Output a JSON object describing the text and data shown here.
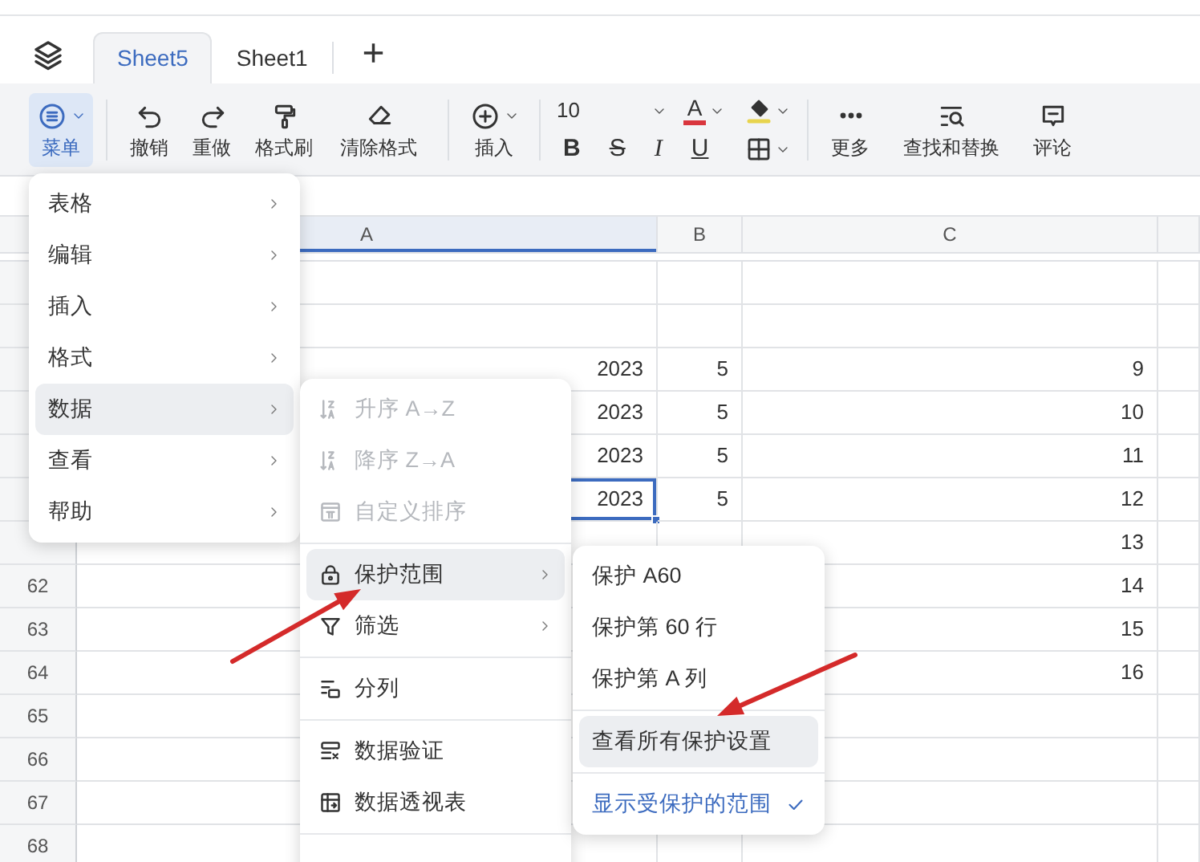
{
  "tab_bar": {
    "tabs": [
      {
        "label": "Sheet5",
        "selected": true
      },
      {
        "label": "Sheet1",
        "selected": false
      }
    ],
    "add_label": "+"
  },
  "toolbar": {
    "menu_button": {
      "label": "菜单",
      "active": true
    },
    "edit_buttons": [
      "撤销",
      "重做",
      "格式刷",
      "清除格式"
    ],
    "insert_button": "插入",
    "font_size": "10",
    "font_color_label": "A",
    "format_buttons": [
      "B",
      "S",
      "I",
      "U"
    ],
    "more_buttons": [
      "更多",
      "查找和替换",
      "评论"
    ]
  },
  "grid": {
    "columns": [
      {
        "label": "A",
        "selected": true
      },
      {
        "label": "B",
        "selected": false
      },
      {
        "label": "C",
        "selected": false
      }
    ],
    "rows": [
      {
        "cells": [
          {
            "kind": "plain"
          },
          {
            "kind": "plain"
          },
          {
            "kind": "plain"
          }
        ]
      },
      {
        "cells": [
          {
            "kind": "plain"
          },
          {
            "kind": "plain"
          },
          {
            "kind": "plain"
          }
        ]
      },
      {
        "cells": [
          {
            "kind": "plain",
            "text": "2023"
          },
          {
            "kind": "plain",
            "text": "5"
          },
          {
            "kind": "plain",
            "text": "9"
          }
        ]
      },
      {
        "cells": [
          {
            "kind": "plain",
            "text": "2023"
          },
          {
            "kind": "plain",
            "text": "5"
          },
          {
            "kind": "plain",
            "text": "10"
          }
        ]
      },
      {
        "cells": [
          {
            "kind": "plain",
            "text": "2023"
          },
          {
            "kind": "plain",
            "text": "5"
          },
          {
            "kind": "plain",
            "text": "11"
          }
        ]
      },
      {
        "cells": [
          {
            "kind": "active",
            "text": "2023"
          },
          {
            "kind": "plain",
            "text": "5"
          },
          {
            "kind": "plain",
            "text": "12"
          }
        ]
      },
      {
        "cells": [
          {
            "kind": "plain"
          },
          {
            "kind": "plain"
          },
          {
            "kind": "plain",
            "text": "13"
          }
        ]
      },
      {
        "number": "62",
        "cells": [
          {
            "kind": "plain"
          },
          {
            "kind": "plain"
          },
          {
            "kind": "plain",
            "text": "14"
          }
        ]
      },
      {
        "number": "63",
        "cells": [
          {
            "kind": "plain"
          },
          {
            "kind": "plain"
          },
          {
            "kind": "plain",
            "text": "15"
          }
        ]
      },
      {
        "number": "64",
        "cells": [
          {
            "kind": "plain"
          },
          {
            "kind": "plain"
          },
          {
            "kind": "plain",
            "text": "16"
          }
        ]
      },
      {
        "number": "65",
        "cells": [
          {
            "kind": "plain"
          },
          {
            "kind": "plain"
          },
          {
            "kind": "plain"
          }
        ]
      },
      {
        "number": "66",
        "cells": [
          {
            "kind": "plain"
          },
          {
            "kind": "plain"
          },
          {
            "kind": "plain"
          }
        ]
      },
      {
        "number": "67",
        "cells": [
          {
            "kind": "plain"
          },
          {
            "kind": "plain"
          },
          {
            "kind": "plain"
          }
        ]
      },
      {
        "number": "68",
        "cells": [
          {
            "kind": "plain"
          },
          {
            "kind": "plain"
          },
          {
            "kind": "plain"
          }
        ]
      }
    ]
  },
  "main_menu": {
    "items": [
      {
        "label": "表格",
        "selected": false
      },
      {
        "label": "编辑",
        "selected": false
      },
      {
        "label": "插入",
        "selected": false
      },
      {
        "label": "格式",
        "selected": false
      },
      {
        "label": "数据",
        "selected": true
      },
      {
        "label": "查看",
        "selected": false
      },
      {
        "label": "帮助",
        "selected": false
      }
    ]
  },
  "data_menu": {
    "items": [
      {
        "kind": "item",
        "label": "升序 A→Z",
        "disabled": true,
        "submenu": false,
        "selected": false
      },
      {
        "kind": "item",
        "label": "降序 Z→A",
        "disabled": true,
        "submenu": false,
        "selected": false
      },
      {
        "kind": "item",
        "label": "自定义排序",
        "disabled": true,
        "submenu": false,
        "selected": false
      },
      {
        "kind": "divider"
      },
      {
        "kind": "item",
        "label": "保护范围",
        "disabled": false,
        "submenu": true,
        "selected": true
      },
      {
        "kind": "item",
        "label": "筛选",
        "disabled": false,
        "submenu": true,
        "selected": false
      },
      {
        "kind": "divider"
      },
      {
        "kind": "item",
        "label": "分列",
        "disabled": false,
        "submenu": false,
        "selected": false
      },
      {
        "kind": "divider"
      },
      {
        "kind": "item",
        "label": "数据验证",
        "disabled": false,
        "submenu": false,
        "selected": false
      },
      {
        "kind": "item",
        "label": "数据透视表",
        "disabled": false,
        "submenu": false,
        "selected": false
      },
      {
        "kind": "divider"
      }
    ]
  },
  "protect_menu": {
    "items": [
      {
        "kind": "item",
        "label": "保护 A60",
        "selected": false
      },
      {
        "kind": "item",
        "label": "保护第 60 行",
        "selected": false
      },
      {
        "kind": "item",
        "label": "保护第 A 列",
        "selected": false
      },
      {
        "kind": "divider"
      },
      {
        "kind": "item",
        "label": "查看所有保护设置",
        "selected": true
      },
      {
        "kind": "divider"
      },
      {
        "kind": "toggle",
        "label": "显示受保护的范围",
        "checked": true
      }
    ]
  }
}
